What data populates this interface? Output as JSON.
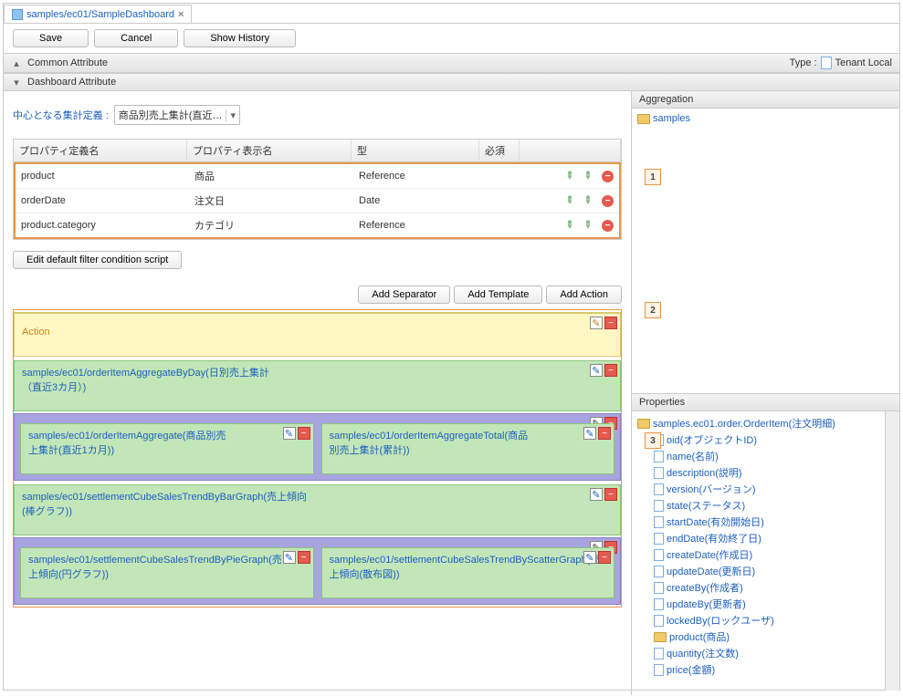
{
  "tab": {
    "label": "samples/ec01/SampleDashboard"
  },
  "toolbar": {
    "save": "Save",
    "cancel": "Cancel",
    "history": "Show History"
  },
  "accordion": {
    "common": "Common Attribute",
    "dashboard": "Dashboard Attribute",
    "type_label": "Type :",
    "type_value": "Tenant Local"
  },
  "aggDef": {
    "label": "中心となる集計定義 :",
    "value": "商品別売上集計(直近…"
  },
  "propHeaders": {
    "name": "プロパティ定義名",
    "display": "プロパティ表示名",
    "type": "型",
    "required": "必須"
  },
  "propRows": [
    {
      "name": "product",
      "display": "商品",
      "type": "Reference"
    },
    {
      "name": "orderDate",
      "display": "注文日",
      "type": "Date"
    },
    {
      "name": "product.category",
      "display": "カテゴリ",
      "type": "Reference"
    }
  ],
  "editFilter": "Edit default filter condition script",
  "addBtns": {
    "sep": "Add Separator",
    "tpl": "Add Template",
    "act": "Add Action"
  },
  "blocks": {
    "action": "Action",
    "byDay": "samples/ec01/orderItemAggregateByDay(日別売上集計（直近3カ月）)",
    "agg": "samples/ec01/orderItemAggregate(商品別売上集計(直近1カ月))",
    "aggTotal": "samples/ec01/orderItemAggregateTotal(商品別売上集計(累計))",
    "bar": "samples/ec01/settlementCubeSalesTrendByBarGraph(売上傾向(棒グラフ))",
    "pie": "samples/ec01/settlementCubeSalesTrendByPieGraph(売上傾向(円グラフ))",
    "scatter": "samples/ec01/settlementCubeSalesTrendByScatterGraph(売上傾向(散布図))"
  },
  "aggregation": {
    "title": "Aggregation",
    "root": "samples"
  },
  "properties": {
    "title": "Properties",
    "root": "samples.ec01.order.OrderItem(注文明細)",
    "items": [
      "oid(オブジェクトID)",
      "name(名前)",
      "description(説明)",
      "version(バージョン)",
      "state(ステータス)",
      "startDate(有効開始日)",
      "endDate(有効終了日)",
      "createDate(作成日)",
      "updateDate(更新日)",
      "createBy(作成者)",
      "updateBy(更新者)",
      "lockedBy(ロックユーザ)",
      "product(商品)",
      "quantity(注文数)",
      "price(金額)"
    ]
  },
  "callouts": {
    "c1": "1",
    "c2": "2",
    "c3": "3"
  }
}
